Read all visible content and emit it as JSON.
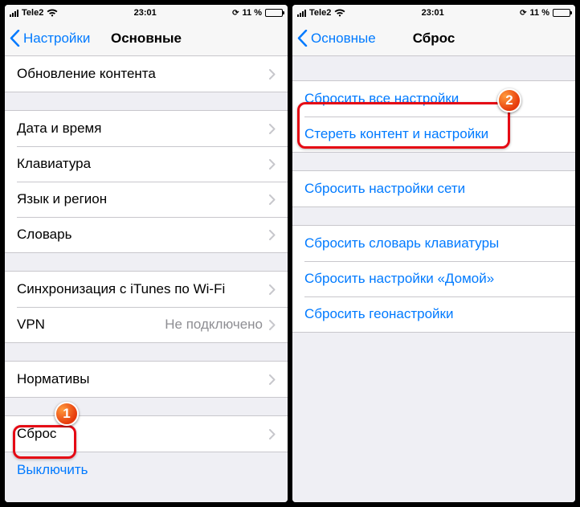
{
  "status": {
    "carrier": "Tele2",
    "time": "23:01",
    "battery_pct": "11 %"
  },
  "left": {
    "back_label": "Настройки",
    "title": "Основные",
    "group0": {
      "content_update": "Обновление контента"
    },
    "group1": {
      "date_time": "Дата и время",
      "keyboard": "Клавиатура",
      "lang_region": "Язык и регион",
      "dictionary": "Словарь"
    },
    "group2": {
      "itunes_wifi": "Синхронизация с iTunes по Wi-Fi",
      "vpn": "VPN",
      "vpn_status": "Не подключено"
    },
    "group3": {
      "regulatory": "Нормативы"
    },
    "group4": {
      "reset": "Сброс"
    },
    "shutdown": "Выключить",
    "callout_badge": "1"
  },
  "right": {
    "back_label": "Основные",
    "title": "Сброс",
    "group0": {
      "reset_all": "Сбросить все настройки",
      "erase_all": "Стереть контент и настройки"
    },
    "group1": {
      "reset_network": "Сбросить настройки сети"
    },
    "group2": {
      "reset_keyboard": "Сбросить словарь клавиатуры",
      "reset_home": "Сбросить настройки «Домой»",
      "reset_location": "Сбросить геонастройки"
    },
    "callout_badge": "2"
  }
}
